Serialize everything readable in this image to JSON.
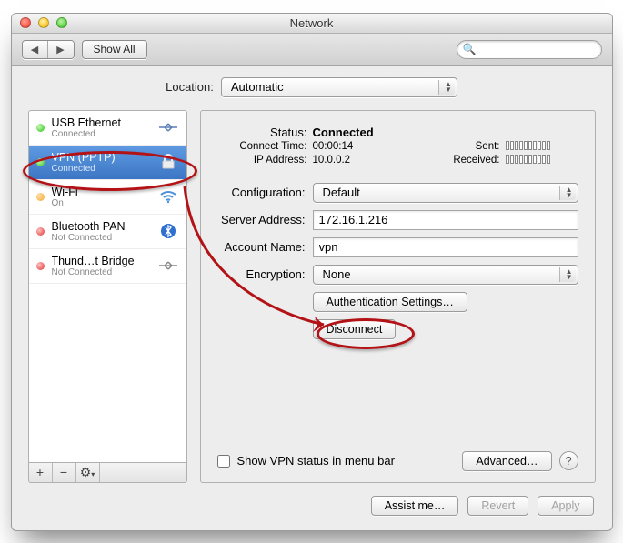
{
  "window": {
    "title": "Network"
  },
  "toolbar": {
    "back_tooltip": "Back",
    "forward_tooltip": "Forward",
    "show_all": "Show All",
    "search_placeholder": ""
  },
  "location": {
    "label": "Location:",
    "value": "Automatic"
  },
  "sidebar": {
    "items": [
      {
        "name": "USB Ethernet",
        "sub": "Connected",
        "status": "green",
        "icon": "ethernet-arrows-icon"
      },
      {
        "name": "VPN (PPTP)",
        "sub": "Connected",
        "status": "green",
        "icon": "lock-icon",
        "selected": true
      },
      {
        "name": "Wi-Fi",
        "sub": "On",
        "status": "orange",
        "icon": "wifi-icon"
      },
      {
        "name": "Bluetooth PAN",
        "sub": "Not Connected",
        "status": "red",
        "icon": "bluetooth-icon"
      },
      {
        "name": "Thund…t Bridge",
        "sub": "Not Connected",
        "status": "red",
        "icon": "ethernet-arrows-icon"
      }
    ],
    "add_label": "+",
    "remove_label": "−",
    "gear_label": "⚙"
  },
  "main": {
    "status_label": "Status:",
    "status_value": "Connected",
    "connect_time_label": "Connect Time:",
    "connect_time_value": "00:00:14",
    "ip_label": "IP Address:",
    "ip_value": "10.0.0.2",
    "sent_label": "Sent:",
    "received_label": "Received:",
    "configuration_label": "Configuration:",
    "configuration_value": "Default",
    "server_label": "Server Address:",
    "server_value": "172.16.1.216",
    "account_label": "Account Name:",
    "account_value": "vpn",
    "encryption_label": "Encryption:",
    "encryption_value": "None",
    "auth_settings": "Authentication Settings…",
    "disconnect": "Disconnect",
    "show_vpn_status": "Show VPN status in menu bar",
    "advanced": "Advanced…",
    "help_tooltip": "?"
  },
  "footer": {
    "assist": "Assist me…",
    "revert": "Revert",
    "apply": "Apply"
  }
}
